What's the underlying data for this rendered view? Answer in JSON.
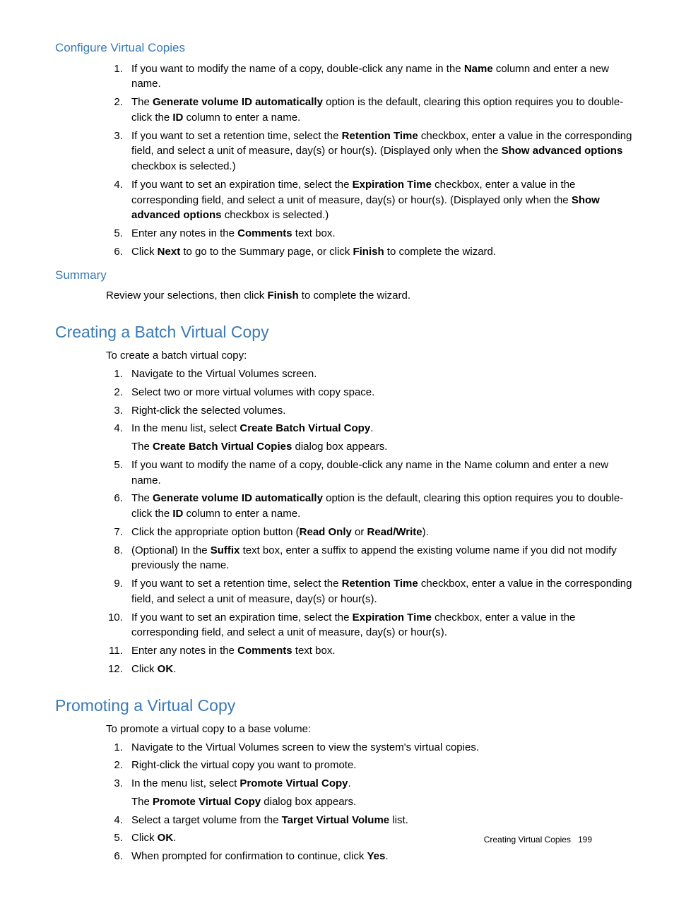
{
  "s1": {
    "title": "Configure Virtual Copies",
    "items": [
      [
        {
          "t": "If you want to modify the name of a copy, double-click any name in the "
        },
        {
          "b": "Name"
        },
        {
          "t": " column and enter a new name."
        }
      ],
      [
        {
          "t": "The "
        },
        {
          "b": "Generate volume ID automatically"
        },
        {
          "t": " option is the default, clearing this option requires you to double-click the "
        },
        {
          "b": "ID"
        },
        {
          "t": " column to enter a name."
        }
      ],
      [
        {
          "t": "If you want to set a retention time, select the "
        },
        {
          "b": "Retention Time"
        },
        {
          "t": " checkbox, enter a value in the corresponding field, and select a unit of measure, day(s) or hour(s). (Displayed only when the "
        },
        {
          "b": "Show advanced options"
        },
        {
          "t": " checkbox is selected.)"
        }
      ],
      [
        {
          "t": "If you want to set an expiration time, select the "
        },
        {
          "b": "Expiration Time"
        },
        {
          "t": " checkbox, enter a value in the corresponding field, and select a unit of measure, day(s) or hour(s). (Displayed only when the "
        },
        {
          "b": "Show advanced options"
        },
        {
          "t": " checkbox is selected.)"
        }
      ],
      [
        {
          "t": "Enter any notes in the "
        },
        {
          "b": "Comments"
        },
        {
          "t": " text box."
        }
      ],
      [
        {
          "t": "Click "
        },
        {
          "b": "Next"
        },
        {
          "t": " to go to the Summary page, or click "
        },
        {
          "b": "Finish"
        },
        {
          "t": " to complete the wizard."
        }
      ]
    ]
  },
  "s2": {
    "title": "Summary",
    "para": [
      {
        "t": "Review your selections, then click "
      },
      {
        "b": "Finish"
      },
      {
        "t": " to complete the wizard."
      }
    ]
  },
  "s3": {
    "title": "Creating a Batch Virtual Copy",
    "intro": "To create a batch virtual copy:",
    "items": [
      [
        {
          "t": "Navigate to the Virtual Volumes screen."
        }
      ],
      [
        {
          "t": "Select two or more virtual volumes with copy space."
        }
      ],
      [
        {
          "t": "Right-click the selected volumes."
        }
      ],
      [
        {
          "t": "In the menu list, select "
        },
        {
          "b": "Create Batch Virtual Copy"
        },
        {
          "t": "."
        },
        {
          "br": true
        },
        {
          "t": "The "
        },
        {
          "b": "Create Batch Virtual Copies"
        },
        {
          "t": " dialog box appears."
        }
      ],
      [
        {
          "t": "If you want to modify the name of a copy, double-click any name in the Name column and enter a new name."
        }
      ],
      [
        {
          "t": "The "
        },
        {
          "b": "Generate volume ID automatically"
        },
        {
          "t": " option is the default, clearing this option requires you to double-click the "
        },
        {
          "b": "ID"
        },
        {
          "t": " column to enter a name."
        }
      ],
      [
        {
          "t": "Click the appropriate option button ("
        },
        {
          "b": "Read Only"
        },
        {
          "t": " or "
        },
        {
          "b": "Read/Write"
        },
        {
          "t": ")."
        }
      ],
      [
        {
          "t": "(Optional) In the "
        },
        {
          "b": "Suffix"
        },
        {
          "t": " text box, enter a suffix to append the existing volume name if you did not modify previously the name."
        }
      ],
      [
        {
          "t": "If you want to set a retention time, select the "
        },
        {
          "b": "Retention Time"
        },
        {
          "t": " checkbox, enter a value in the corresponding field, and select a unit of measure, day(s) or hour(s)."
        }
      ],
      [
        {
          "t": "If you want to set an expiration time, select the "
        },
        {
          "b": "Expiration Time"
        },
        {
          "t": " checkbox, enter a value in the corresponding field, and select a unit of measure, day(s) or hour(s)."
        }
      ],
      [
        {
          "t": "Enter any notes in the "
        },
        {
          "b": "Comments"
        },
        {
          "t": " text box."
        }
      ],
      [
        {
          "t": "Click "
        },
        {
          "b": "OK"
        },
        {
          "t": "."
        }
      ]
    ]
  },
  "s4": {
    "title": "Promoting a Virtual Copy",
    "intro": "To promote a virtual copy to a base volume:",
    "items": [
      [
        {
          "t": "Navigate to the Virtual Volumes screen to view the system's virtual copies."
        }
      ],
      [
        {
          "t": "Right-click the virtual copy you want to promote."
        }
      ],
      [
        {
          "t": "In the menu list, select "
        },
        {
          "b": "Promote Virtual Copy"
        },
        {
          "t": "."
        },
        {
          "br": true
        },
        {
          "t": "The "
        },
        {
          "b": "Promote Virtual Copy"
        },
        {
          "t": " dialog box appears."
        }
      ],
      [
        {
          "t": "Select a target volume from the "
        },
        {
          "b": "Target Virtual Volume"
        },
        {
          "t": " list."
        }
      ],
      [
        {
          "t": "Click "
        },
        {
          "b": "OK"
        },
        {
          "t": "."
        }
      ],
      [
        {
          "t": "When prompted for confirmation to continue, click "
        },
        {
          "b": "Yes"
        },
        {
          "t": "."
        }
      ]
    ]
  },
  "footer": {
    "label": "Creating Virtual Copies",
    "page": "199"
  }
}
